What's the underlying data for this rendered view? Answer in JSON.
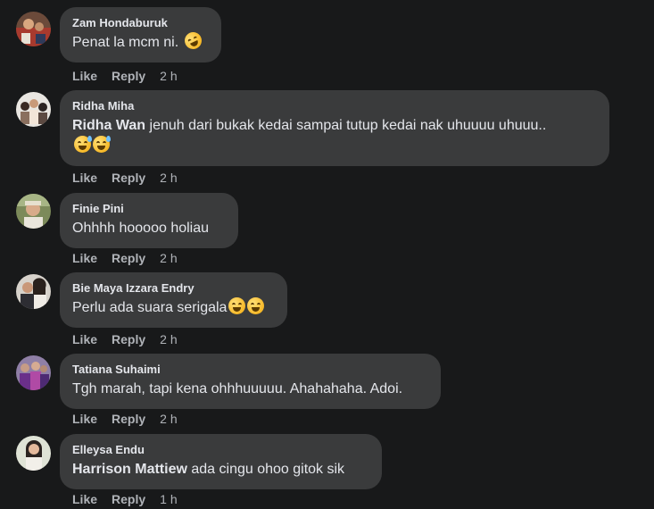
{
  "comments": [
    {
      "author": "Zam Hondaburuk",
      "mention": "",
      "text": "Penat la mcm ni.",
      "emojis": [
        "rofl-emoji"
      ],
      "like": "Like",
      "reply": "Reply",
      "time": "2 h"
    },
    {
      "author": "Ridha Miha",
      "mention": "Ridha Wan",
      "text": "jenuh dari bukak kedai sampai tutup kedai nak uhuuuu uhuuu..",
      "emojis": [
        "sweat-smile-emoji",
        "sweat-smile-emoji"
      ],
      "like": "Like",
      "reply": "Reply",
      "time": "2 h"
    },
    {
      "author": "Finie Pini",
      "mention": "",
      "text": "Ohhhh hooooo holiau",
      "emojis": [],
      "like": "Like",
      "reply": "Reply",
      "time": "2 h"
    },
    {
      "author": "Bie Maya Izzara Endry",
      "mention": "",
      "text": "Perlu ada suara serigala",
      "emojis": [
        "laughing-emoji",
        "laughing-emoji"
      ],
      "like": "Like",
      "reply": "Reply",
      "time": "2 h"
    },
    {
      "author": "Tatiana Suhaimi",
      "mention": "",
      "text": "Tgh marah, tapi kena ohhhuuuuu. Ahahahaha. Adoi.",
      "emojis": [],
      "like": "Like",
      "reply": "Reply",
      "time": "2 h"
    },
    {
      "author": "Elleysa Endu",
      "mention": "Harrison Mattiew",
      "text": "ada cingu ohoo gitok sik",
      "emojis": [],
      "like": "Like",
      "reply": "Reply",
      "time": "1 h"
    }
  ],
  "colors": {
    "background": "#18191a",
    "bubble": "#3a3b3c",
    "text_primary": "#e4e6eb",
    "text_secondary": "#b0b3b8"
  }
}
